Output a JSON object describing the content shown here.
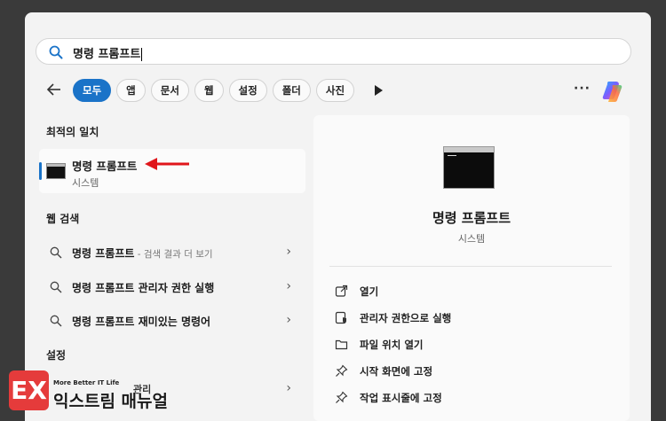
{
  "search": {
    "value": "명령 프롬프트"
  },
  "filters": [
    "모두",
    "앱",
    "문서",
    "웹",
    "설정",
    "폴더",
    "사진"
  ],
  "best_match": {
    "heading": "최적의 일치",
    "title": "명령 프롬프트",
    "subtitle": "시스템"
  },
  "web_search": {
    "heading": "웹 검색",
    "items": [
      {
        "query": "명령 프롬프트",
        "suffix": " - 검색 결과 더 보기",
        "bold": ""
      },
      {
        "query": "명령 프롬프트 ",
        "suffix": "",
        "bold": "관리자 권한 실행"
      },
      {
        "query": "명령 프롬프트 ",
        "suffix": "",
        "bold": "재미있는 명령어"
      }
    ]
  },
  "settings": {
    "heading": "설정",
    "partial_item": "관리"
  },
  "detail": {
    "title": "명령 프롬프트",
    "subtitle": "시스템",
    "actions": [
      {
        "label": "열기",
        "icon": "open-external-icon"
      },
      {
        "label": "관리자 권한으로 실행",
        "icon": "admin-shield-icon"
      },
      {
        "label": "파일 위치 열기",
        "icon": "folder-icon"
      },
      {
        "label": "시작 화면에 고정",
        "icon": "pin-icon"
      },
      {
        "label": "작업 표시줄에 고정",
        "icon": "pin-icon"
      }
    ]
  },
  "watermark": {
    "logo": "EX",
    "tagline": "More Better IT Life",
    "name": "익스트림 매뉴얼"
  },
  "colors": {
    "accent": "#1a73c8",
    "arrow": "#e0161b",
    "logo": "#e53b3b"
  }
}
